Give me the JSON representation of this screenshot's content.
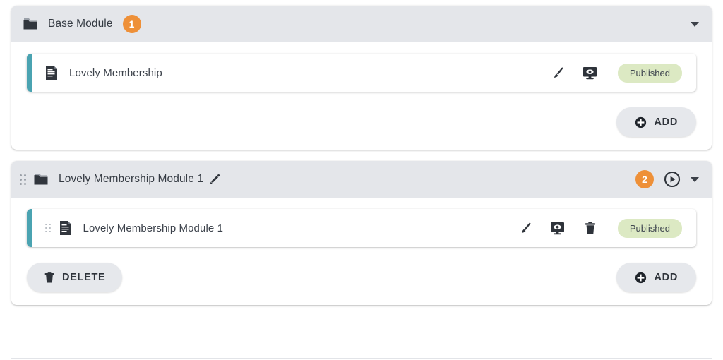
{
  "modules": [
    {
      "id": "base-module",
      "title": "Base Module",
      "count_badge": "1",
      "has_drag_handle": false,
      "has_edit_pencil": false,
      "has_play_button": false,
      "collapse_icon": "chevron-down-icon",
      "folder_icon": "folder-icon",
      "lessons": [
        {
          "title": "Lovely Membership",
          "doc_icon": "document-icon",
          "has_drag_handle": false,
          "actions": [
            "brush-icon",
            "preview-monitor-icon"
          ],
          "status": "Published"
        }
      ],
      "footer": {
        "delete_label": null,
        "add_label": "ADD"
      }
    },
    {
      "id": "lovely-membership-module-1",
      "title": "Lovely Membership Module 1",
      "count_badge": "2",
      "has_drag_handle": true,
      "has_edit_pencil": true,
      "has_play_button": true,
      "collapse_icon": "chevron-down-icon",
      "folder_icon": "folder-icon",
      "lessons": [
        {
          "title": "Lovely Membership Module 1",
          "doc_icon": "document-icon",
          "has_drag_handle": true,
          "actions": [
            "brush-icon",
            "preview-monitor-icon",
            "trash-icon"
          ],
          "status": "Published"
        }
      ],
      "footer": {
        "delete_label": "DELETE",
        "add_label": "ADD"
      }
    }
  ],
  "colors": {
    "header_background": "#e4e6ea",
    "accent_teal": "#4aa3b1",
    "badge_orange": "#ee9038",
    "status_green": "#dce9c3",
    "button_gray": "#e6e8ec",
    "text_dark": "#3b414a"
  }
}
